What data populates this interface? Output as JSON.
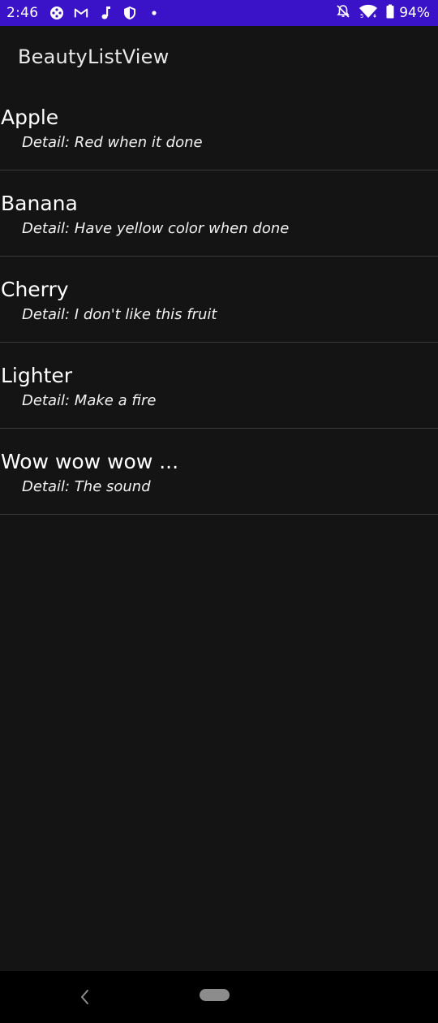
{
  "status_bar": {
    "time": "2:46",
    "battery_text": "94%",
    "left_icons": [
      "game-controller-icon",
      "gmail-icon",
      "music-note-icon",
      "shield-icon",
      "dot-icon"
    ],
    "right_icons": [
      "bell-off-icon",
      "wifi-icon",
      "battery-icon"
    ],
    "bg_color": "#3a12c8"
  },
  "app_bar": {
    "title": "BeautyListView"
  },
  "list": {
    "items": [
      {
        "title": "Apple",
        "detail": "Detail: Red when it done"
      },
      {
        "title": "Banana",
        "detail": "Detail: Have yellow color when done"
      },
      {
        "title": "Cherry",
        "detail": "Detail: I don't like this fruit"
      },
      {
        "title": "Lighter",
        "detail": "Detail: Make a fire"
      },
      {
        "title": "Wow wow wow ...",
        "detail": "Detail: The sound"
      }
    ]
  },
  "nav_bar": {
    "icons": [
      "back-icon",
      "home-pill-icon"
    ]
  },
  "colors": {
    "background": "#141414",
    "divider": "#3a3a3a",
    "nav_bg": "#000000"
  }
}
